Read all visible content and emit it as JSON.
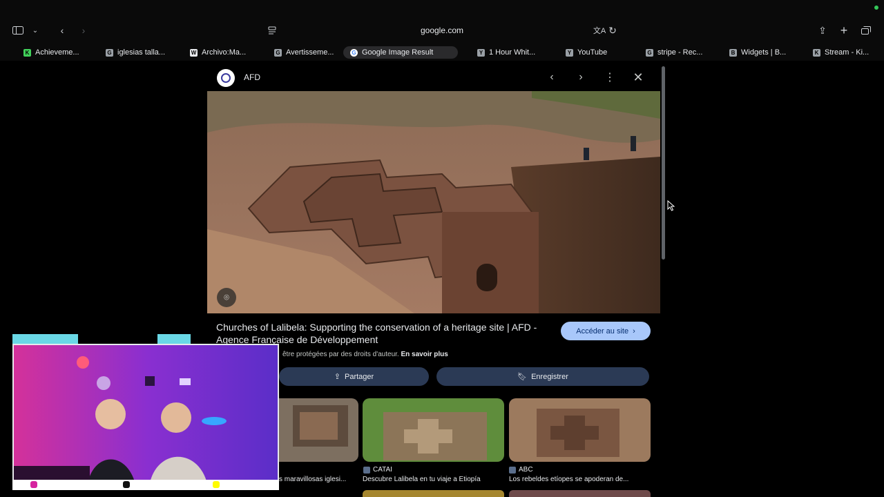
{
  "browser": {
    "url": "google.com",
    "tabs": [
      {
        "label": "Achieveme...",
        "favicon": "K"
      },
      {
        "label": "iglesias talla...",
        "favicon": "G"
      },
      {
        "label": "Archivo:Ma...",
        "favicon": "W"
      },
      {
        "label": "Avertisseme...",
        "favicon": "G"
      },
      {
        "label": "Google Image Result",
        "favicon": "G",
        "active": true
      },
      {
        "label": "1 Hour Whit...",
        "favicon": "Y"
      },
      {
        "label": "YouTube",
        "favicon": "Y"
      },
      {
        "label": "stripe - Rec...",
        "favicon": "G"
      },
      {
        "label": "Widgets | B...",
        "favicon": "B"
      },
      {
        "label": "Stream - Ki...",
        "favicon": "K"
      }
    ]
  },
  "panel": {
    "source_name": "AFD",
    "title": "Churches of Lalibela: Supporting the conservation of a heritage site | AFD - Agence Française de Développement",
    "visit_label": "Accéder au site",
    "copyright_text": "être protégées par des droits d'auteur.",
    "copyright_link": "En savoir plus",
    "share_label": "Partager",
    "save_label": "Enregistrer",
    "related": [
      {
        "source": "",
        "caption": "s maravillosas iglesi..."
      },
      {
        "source": "CATAI",
        "caption": "Descubre Lalibela en tu viaje a Etiopía"
      },
      {
        "source": "ABC",
        "caption": "Los rebeldes etíopes se apoderan de..."
      }
    ]
  }
}
